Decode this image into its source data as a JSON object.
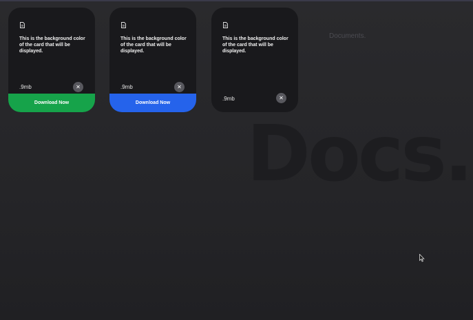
{
  "background": {
    "watermark": "Docs.",
    "subtitle": "Documents."
  },
  "cards": [
    {
      "icon": "document-icon",
      "description": "This is the background color of the card that will be displayed.",
      "size": ".9mb",
      "close_label": "✕",
      "download_label": "Download Now",
      "download_color": "#16a34a"
    },
    {
      "icon": "document-icon",
      "description": "This is the background color of the card that will be displayed.",
      "size": ".9mb",
      "close_label": "✕",
      "download_label": "Download Now",
      "download_color": "#2563eb"
    },
    {
      "icon": "document-icon",
      "description": "This is the background color of the card that will be displayed.",
      "size": ".9mb",
      "close_label": "✕"
    }
  ],
  "colors": {
    "card_background": "#19191c",
    "page_background": "#252528",
    "close_button": "#58585e"
  }
}
